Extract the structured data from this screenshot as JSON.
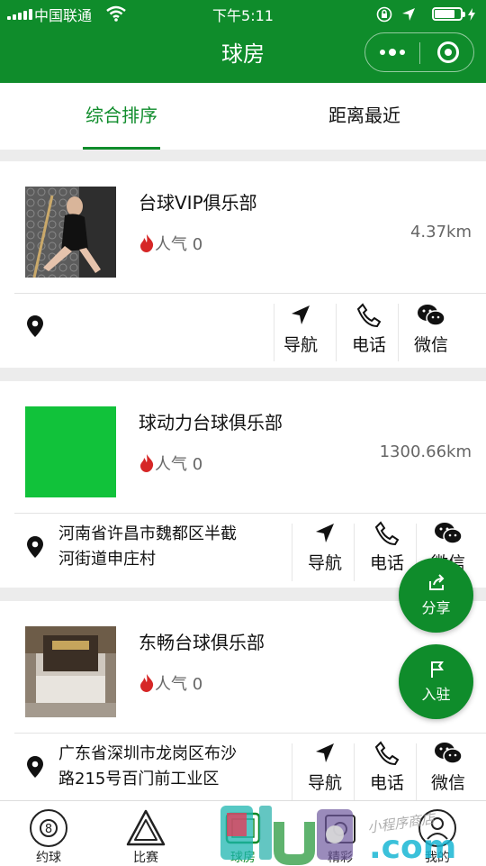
{
  "status_bar": {
    "carrier": "中国联通",
    "time": "下午5:11"
  },
  "nav": {
    "title": "球房"
  },
  "tabs": [
    {
      "label": "综合排序",
      "active": true
    },
    {
      "label": "距离最近",
      "active": false
    }
  ],
  "venues": [
    {
      "name": "台球VIP俱乐部",
      "popularity_label": "人气",
      "popularity": "0",
      "distance": "4.37km",
      "address": ""
    },
    {
      "name": "球动力台球俱乐部",
      "popularity_label": "人气",
      "popularity": "0",
      "distance": "1300.66km",
      "address_line1": "河南省许昌市魏都区半截",
      "address_line2": "河街道申庄村"
    },
    {
      "name": "东畅台球俱乐部",
      "popularity_label": "人气",
      "popularity": "0",
      "distance": "",
      "address_line1": "广东省深圳市龙岗区布沙",
      "address_line2": "路215号百门前工业区"
    }
  ],
  "actions": {
    "navigate": "导航",
    "call": "电话",
    "wechat": "微信"
  },
  "fab": {
    "share": "分享",
    "join": "入驻"
  },
  "tabbar": [
    {
      "label": "约球",
      "icon": "billiard-8-ball-icon"
    },
    {
      "label": "比赛",
      "icon": "triangle-rack-icon"
    },
    {
      "label": "球房",
      "icon": "pool-table-icon"
    },
    {
      "label": "精彩",
      "icon": "highlights-icon"
    },
    {
      "label": "我的",
      "icon": "user-icon"
    }
  ],
  "watermark": {
    "text": "llue.com",
    "handwriting": "小程序商店"
  },
  "colors": {
    "brand": "#0f8c2b",
    "flame": "#d62626",
    "thumb2": "#11c23a"
  }
}
